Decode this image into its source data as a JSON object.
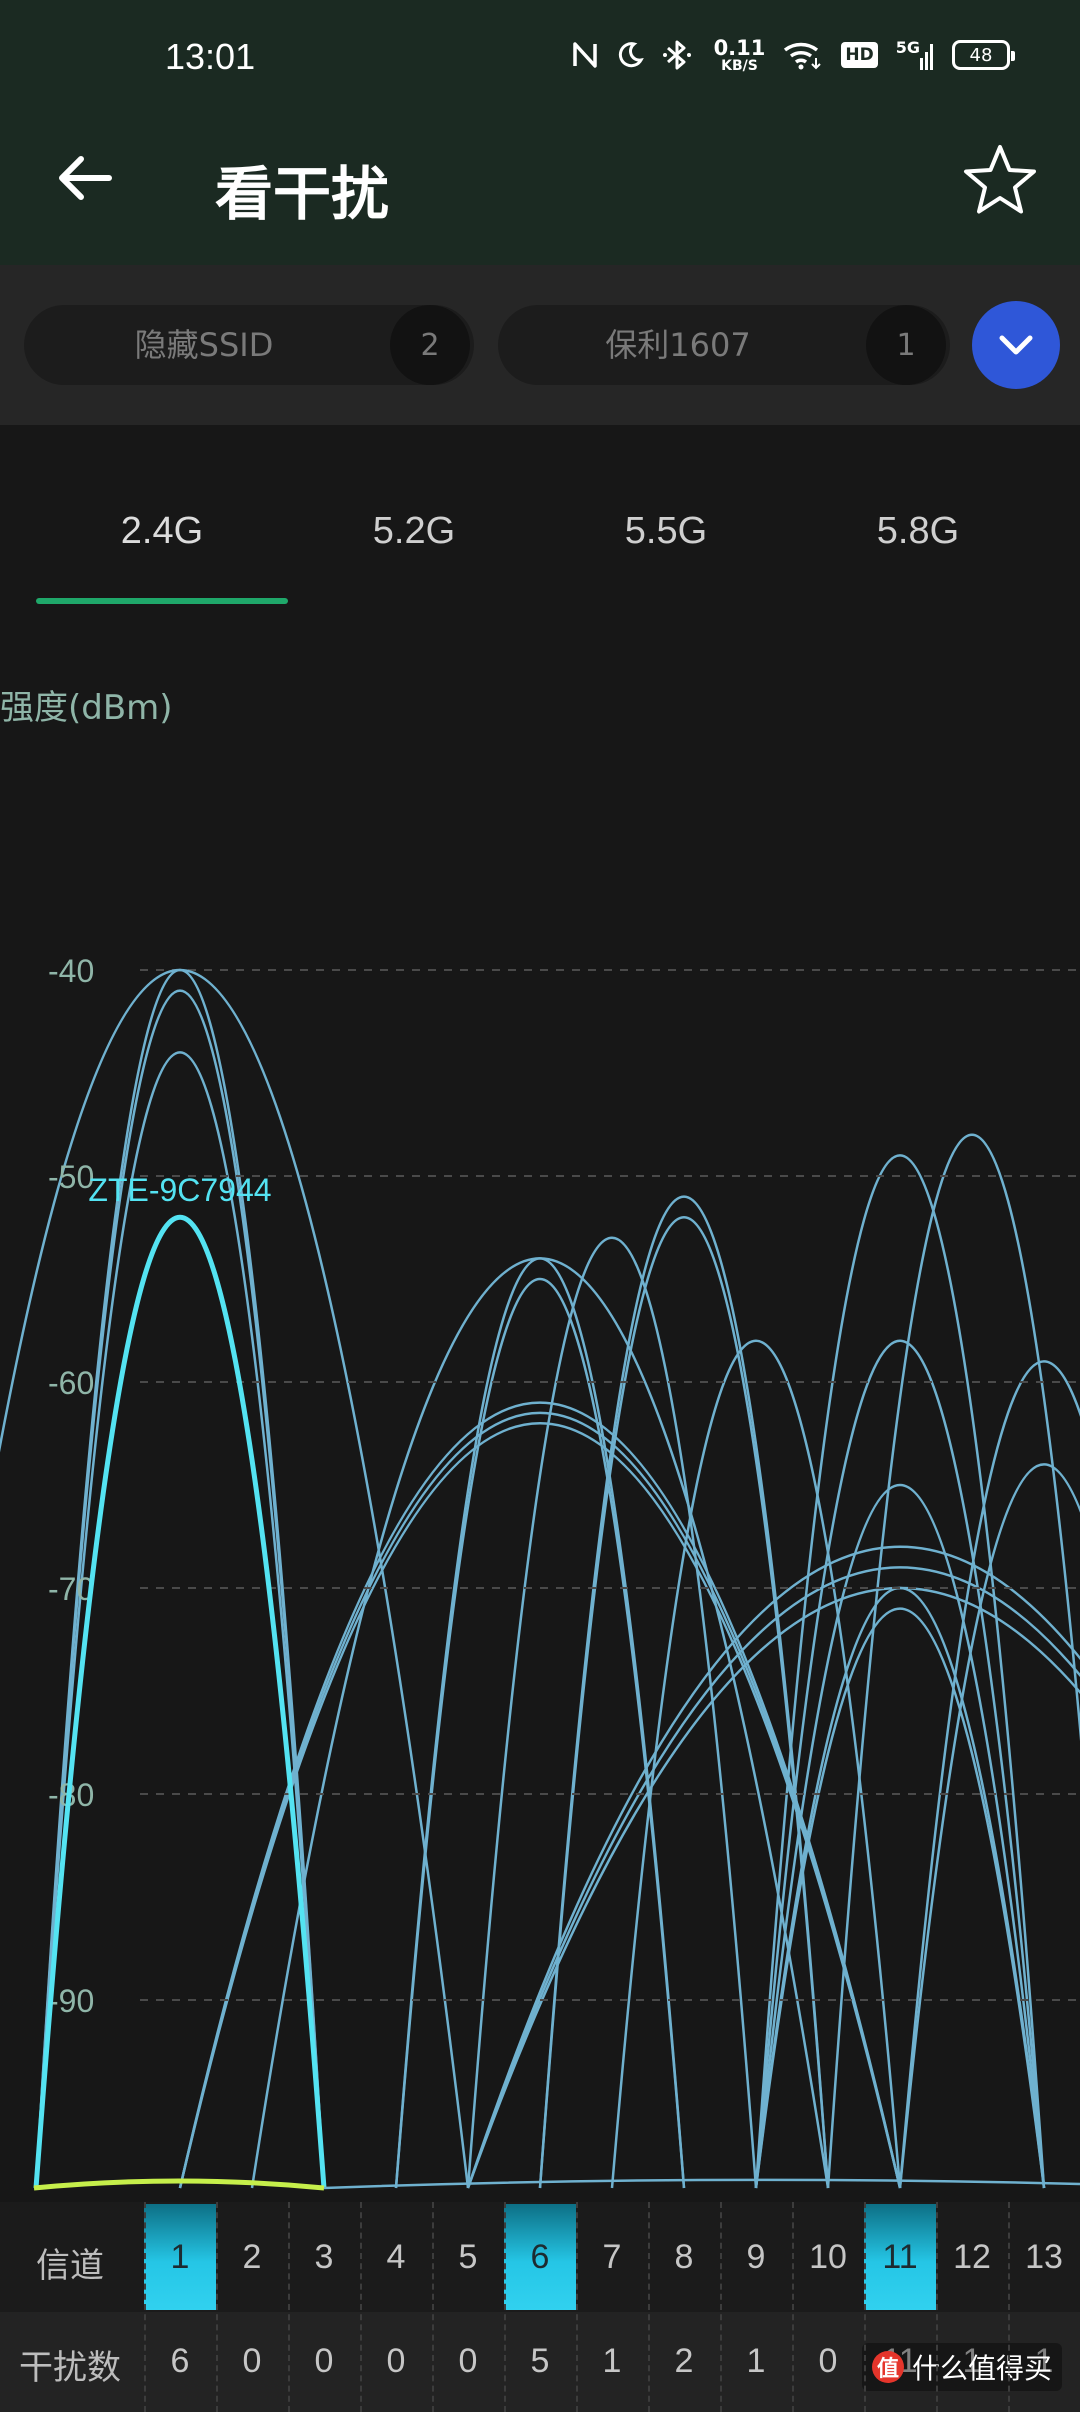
{
  "status_bar": {
    "time": "13:01",
    "net_speed_value": "0.11",
    "net_speed_unit": "KB/S",
    "hd_label": "HD",
    "net_label": "5G",
    "battery": "48",
    "icons": [
      "nfc-icon",
      "moon-icon",
      "bluetooth-icon",
      "wifi-icon",
      "signal-icon"
    ]
  },
  "app_bar": {
    "title": "看干扰",
    "back_icon": "arrow-left-icon",
    "fav_icon": "star-outline-icon"
  },
  "filters": [
    {
      "label": "隐藏SSID",
      "count": "2"
    },
    {
      "label": "保利1607",
      "count": "1"
    }
  ],
  "expand_icon": "chevron-down-icon",
  "tabs": [
    {
      "label": "2.4G",
      "active": true
    },
    {
      "label": "5.2G",
      "active": false
    },
    {
      "label": "5.5G",
      "active": false
    },
    {
      "label": "5.8G",
      "active": false
    }
  ],
  "colors": {
    "accent_green": "#1fa86a",
    "curve": "#6fb1cf",
    "highlight_curve": "#54e3f2",
    "floor_curve": "#c6ef4b",
    "expand_blue": "#2f57d8"
  },
  "chart_data": {
    "type": "line",
    "ylabel": "强度(dBm)",
    "y_ticks": [
      "-40",
      "-50",
      "-60",
      "-70",
      "-80",
      "-90"
    ],
    "ylim": [
      -99,
      -40
    ],
    "x_channels": [
      "1",
      "2",
      "3",
      "4",
      "5",
      "6",
      "7",
      "8",
      "9",
      "10",
      "11",
      "12",
      "13"
    ],
    "grid": true,
    "highlight_label": "ZTE-9C7944",
    "series": [
      {
        "name": "ZTE-9C7944",
        "highlight": true,
        "center": 1,
        "half_width": 2,
        "peak": -52
      },
      {
        "center": 1,
        "half_width": 2,
        "peak": -40
      },
      {
        "center": 1,
        "half_width": 2,
        "peak": -41
      },
      {
        "center": 1,
        "half_width": 2,
        "peak": -44
      },
      {
        "center": 1,
        "half_width": 4,
        "peak": -40
      },
      {
        "center": 6,
        "half_width": 2,
        "peak": -55
      },
      {
        "center": 6,
        "half_width": 2,
        "peak": -54
      },
      {
        "center": 6,
        "half_width": 4,
        "peak": -54
      },
      {
        "center": 6,
        "half_width": 5,
        "peak": -61
      },
      {
        "center": 6,
        "half_width": 5,
        "peak": -61.5
      },
      {
        "center": 6,
        "half_width": 5,
        "peak": -62
      },
      {
        "center": 7,
        "half_width": 2,
        "peak": -53
      },
      {
        "center": 8,
        "half_width": 2,
        "peak": -51
      },
      {
        "center": 8,
        "half_width": 2,
        "peak": -52
      },
      {
        "center": 9,
        "half_width": 2,
        "peak": -58
      },
      {
        "center": 11,
        "half_width": 2,
        "peak": -49
      },
      {
        "center": 11,
        "half_width": 2,
        "peak": -65
      },
      {
        "center": 11,
        "half_width": 2,
        "peak": -70
      },
      {
        "center": 11,
        "half_width": 2,
        "peak": -71
      },
      {
        "center": 11,
        "half_width": 2,
        "peak": -58
      },
      {
        "center": 11,
        "half_width": 6,
        "peak": -68
      },
      {
        "center": 11,
        "half_width": 6,
        "peak": -69
      },
      {
        "center": 11,
        "half_width": 6,
        "peak": -70
      },
      {
        "center": 12,
        "half_width": 2,
        "peak": -48
      },
      {
        "center": 13,
        "half_width": 2,
        "peak": -59
      },
      {
        "center": 13,
        "half_width": 2,
        "peak": -64
      }
    ]
  },
  "channel_row": {
    "label": "信道",
    "channels": [
      "1",
      "2",
      "3",
      "4",
      "5",
      "6",
      "7",
      "8",
      "9",
      "10",
      "11",
      "12",
      "13"
    ],
    "highlighted": [
      "1",
      "6",
      "11"
    ]
  },
  "interference_row": {
    "label": "干扰数",
    "counts": [
      "6",
      "0",
      "0",
      "0",
      "0",
      "5",
      "1",
      "2",
      "1",
      "0",
      "11",
      "1",
      "1"
    ]
  },
  "watermark": {
    "text": "什么值得买",
    "logo_text": "值"
  }
}
